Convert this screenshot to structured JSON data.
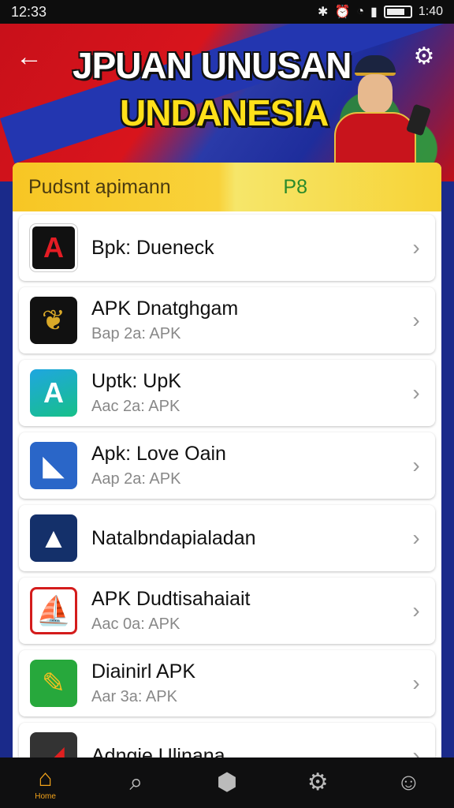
{
  "status": {
    "time_left": "12:33",
    "time_right": "1:40"
  },
  "banner": {
    "line1": "JPUAN UNUSAN",
    "line2": "UNDANESIA"
  },
  "panel": {
    "title": "Pudsnt apimann",
    "count": "P8"
  },
  "apps": [
    {
      "name": "Bpk: Dueneck",
      "sub": "",
      "logo": "A"
    },
    {
      "name": "APK Dnatghgam",
      "sub": "Bap 2a: APK",
      "logo": "❦"
    },
    {
      "name": "Uptk: UpK",
      "sub": "Aac 2a: APK",
      "logo": "A"
    },
    {
      "name": "Apk: Love Oain",
      "sub": "Aap 2a: APK",
      "logo": "◣"
    },
    {
      "name": "Natalbndapialadan",
      "sub": "",
      "logo": "▲"
    },
    {
      "name": "APK Dudtisahaiait",
      "sub": "Aac 0a: APK",
      "logo": "⛵"
    },
    {
      "name": "Diainirl APK",
      "sub": "Aar 3a: APK",
      "logo": "✎"
    },
    {
      "name": "Adngie Ulinana",
      "sub": "",
      "logo": "◢"
    }
  ],
  "nav": {
    "home_label": "Home"
  },
  "colors": {
    "accent": "#f2a21a",
    "header_yellow": "#f7c624",
    "banner_red": "#c8101a",
    "banner_blue": "#2336b0"
  }
}
